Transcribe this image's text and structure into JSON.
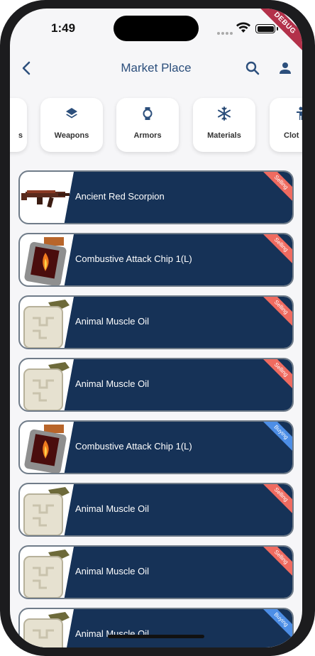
{
  "status_bar": {
    "time": "1:49",
    "debug_label": "DEBUG"
  },
  "app_bar": {
    "title": "Market Place"
  },
  "categories": [
    {
      "label": "s",
      "icon": "partial-icon"
    },
    {
      "label": "Weapons",
      "icon": "layers-icon"
    },
    {
      "label": "Armors",
      "icon": "watch-icon"
    },
    {
      "label": "Materials",
      "icon": "snowflake-icon"
    },
    {
      "label": "Clot",
      "icon": "person-icon"
    }
  ],
  "items": [
    {
      "name": "Ancient Red Scorpion",
      "tag": "Selling",
      "thumb": "gun-icon"
    },
    {
      "name": "Combustive Attack Chip 1(L)",
      "tag": "Selling",
      "thumb": "chip-icon"
    },
    {
      "name": "Animal Muscle Oil",
      "tag": "Selling",
      "thumb": "oil-can-icon"
    },
    {
      "name": "Animal Muscle Oil",
      "tag": "Selling",
      "thumb": "oil-can-icon"
    },
    {
      "name": "Combustive Attack Chip 1(L)",
      "tag": "Buying",
      "thumb": "chip-icon"
    },
    {
      "name": "Animal Muscle Oil",
      "tag": "Selling",
      "thumb": "oil-can-icon"
    },
    {
      "name": "Animal Muscle Oil",
      "tag": "Selling",
      "thumb": "oil-can-icon"
    },
    {
      "name": "Animal Muscle Oil",
      "tag": "Buying",
      "thumb": "oil-can-icon"
    }
  ],
  "colors": {
    "accent": "#2c4f7c",
    "card": "#163257",
    "selling": "#ef6b60",
    "buying": "#4d8ee6"
  }
}
